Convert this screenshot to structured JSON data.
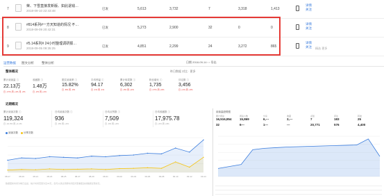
{
  "rows": [
    {
      "idx": "7",
      "title": "荣、下雪直接发新版、如此退钱…",
      "date": "2018-09-10 22:43:48",
      "status": "已发",
      "v1": "5,613",
      "v2": "3,732",
      "v3": "7",
      "v4": "3,318",
      "v5": "1,413",
      "act1": "详情",
      "act2": "关注"
    },
    {
      "idx": "8",
      "title": "#814系列#一方天知道的情况 不…",
      "date": "2018-09-09 20:42:31",
      "status": "已发",
      "v1": "5,273",
      "v2": "2,900",
      "v3": "32",
      "v4": "0",
      "v5": "0",
      "act1": "详情",
      "act2": "关注"
    },
    {
      "idx": "9",
      "title": "#5.14系列# 24小时整理调研报…",
      "date": "2018-09-05 09:35:25",
      "status": "已发",
      "v1": "4,851",
      "v2": "2,299",
      "v3": "24",
      "v4": "3,272",
      "v5": "865",
      "act1": "详情",
      "act2": "关注",
      "extra": "精选·更多"
    }
  ],
  "tabs": [
    "运营数据",
    "图文分析",
    "整体分析"
  ],
  "tabs_right": "日期 2018-09-14   ‹  ›  导出",
  "overview_title": "整体概况",
  "overview_right": "昨日数据   对比 · 更多",
  "metrics": [
    {
      "label": "累计阅读量 ⓘ",
      "value": "22.13万",
      "change": "日 -17% 周 +1% 月 -2%"
    },
    {
      "label": "收藏数 ⓘ",
      "value": "1.48万",
      "change": "日 -2% 周 +1%"
    },
    {
      "label": "图文阅读率 ⓘ",
      "value": "15.82%",
      "change": "日 -8% 周 -3%"
    },
    {
      "label": "平均停留 ⓘ",
      "value": "94.17",
      "change": "日 -1% 周 -1%"
    },
    {
      "label": "累计转发数 ⓘ",
      "value": "6,302",
      "change": "日 -3% 周 +2%"
    },
    {
      "label": "粉丝增长 ⓘ",
      "value": "1,735",
      "change": "日 -17% 周 +6%"
    },
    {
      "label": "评论数 ⓘ",
      "value": "3,456",
      "change": "日 +1% 周 +3%"
    }
  ],
  "trend_title": "近期概况",
  "stats": [
    {
      "label": "累计阅读次数 ⓘ",
      "value": "119,324",
      "change": "日 -12.3%  周 +4.1%"
    },
    {
      "label": "日均阅读次数 ⓘ",
      "value": "936",
      "change": "日 -3%  周 +1%"
    },
    {
      "label": "日均点赞数 ⓘ",
      "value": "7,509",
      "change": "日 -4%  周 +2%"
    },
    {
      "label": "日均收藏数 ⓘ",
      "value": "17,975.78",
      "change": "日 +1%  周 +3%"
    }
  ],
  "legend": [
    {
      "name": "阅读次数",
      "color": "#3b7ddd"
    },
    {
      "name": "分享次数",
      "color": "#f5c518"
    }
  ],
  "chart_data": {
    "type": "line",
    "x": [
      "08-17",
      "08-19",
      "08-21",
      "08-23",
      "08-25",
      "08-27",
      "08-29",
      "08-31",
      "09-02",
      "09-04",
      "09-06",
      "09-08",
      "09-10",
      "09-12",
      "09-14"
    ],
    "series": [
      {
        "name": "阅读次数",
        "values": [
          2100,
          2500,
          2400,
          2700,
          2600,
          2500,
          2800,
          2700,
          2900,
          3000,
          3300,
          3200,
          4200,
          3500,
          5600
        ]
      },
      {
        "name": "分享次数",
        "values": [
          400,
          500,
          450,
          600,
          500,
          550,
          600,
          500,
          650,
          700,
          800,
          700,
          1800,
          900,
          2600
        ]
      }
    ],
    "ylim": [
      0,
      6000
    ],
    "grid": true
  },
  "chart_footnote": "数据更新时间为每日凌晨，统计时间范围为近30天，您可以通过调整时间区间查看更多的数据表现情况。",
  "panel2": {
    "title": "阅读量趋势图",
    "labels": [
      "累计阅读",
      "阅读人数",
      "分享",
      "收藏",
      "点赞",
      "评论",
      "转发"
    ],
    "values": [
      "16,516,854",
      "15,869",
      "6,---",
      "3,---",
      "7",
      "183",
      "25"
    ],
    "values2": [
      "32",
      "6---",
      "1---",
      "---",
      "20,771",
      "576",
      "4,400"
    ],
    "chart2": {
      "type": "line",
      "values": [
        120,
        150,
        180,
        400,
        420,
        430,
        440,
        445,
        450,
        455,
        460,
        465,
        470,
        560,
        300
      ],
      "ylim": [
        0,
        600
      ]
    }
  }
}
